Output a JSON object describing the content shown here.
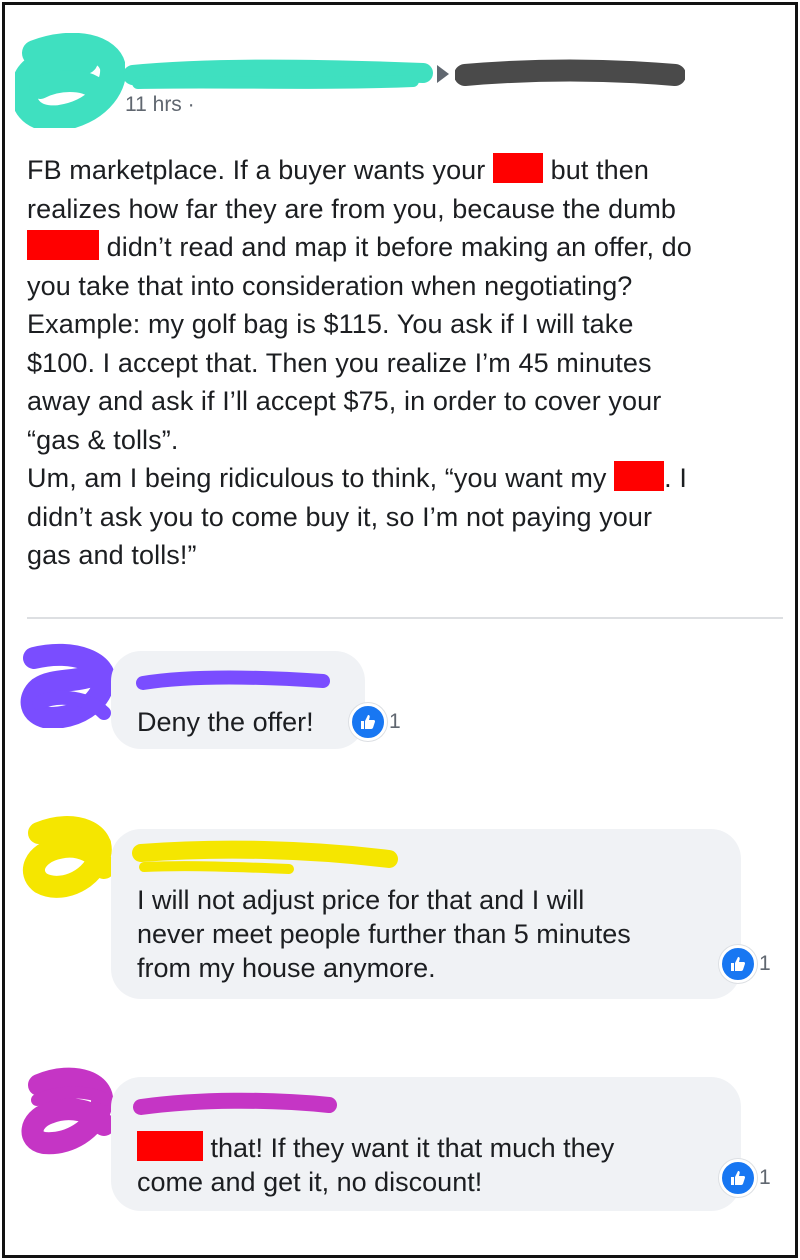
{
  "post": {
    "time": "11 hrs ·",
    "text_parts": [
      "FB marketplace. If a buyer wants your ",
      " but then\nrealizes how far they are from you, because the dumb\n",
      " didn’t read and map it before making an offer, do\nyou take that into consideration when negotiating?\nExample: my golf bag is $115. You ask if I will take\n$100. I accept that. Then you realize I’m 45 minutes\naway and ask if I’ll accept $75, in order to cover your\n“gas & tolls”.\nUm, am I being ridiculous to think, “you want my ",
      ". I\ndidn’t ask you to come buy it, so I’m not paying your\ngas and tolls!”"
    ]
  },
  "comments": [
    {
      "text": "Deny the offer!",
      "likes": "1"
    },
    {
      "text": "I will not adjust price for that and I will\nnever meet people further than 5 minutes\nfrom my house anymore.",
      "likes": "1"
    },
    {
      "text_after_redaction": " that! If they want it that much they\ncome and get it, no discount!",
      "likes": "1"
    }
  ],
  "colors": {
    "author_scribble": "#3fe0c0",
    "page_scribble": "#4a4a4a",
    "redaction": "#ff0000",
    "commenter1": "#7a4dff",
    "commenter2": "#f5e600",
    "commenter3": "#c535c5",
    "like_blue": "#1877f2",
    "bubble_bg": "#f0f2f5"
  },
  "icons": [
    "like-icon",
    "share-arrow-icon"
  ]
}
